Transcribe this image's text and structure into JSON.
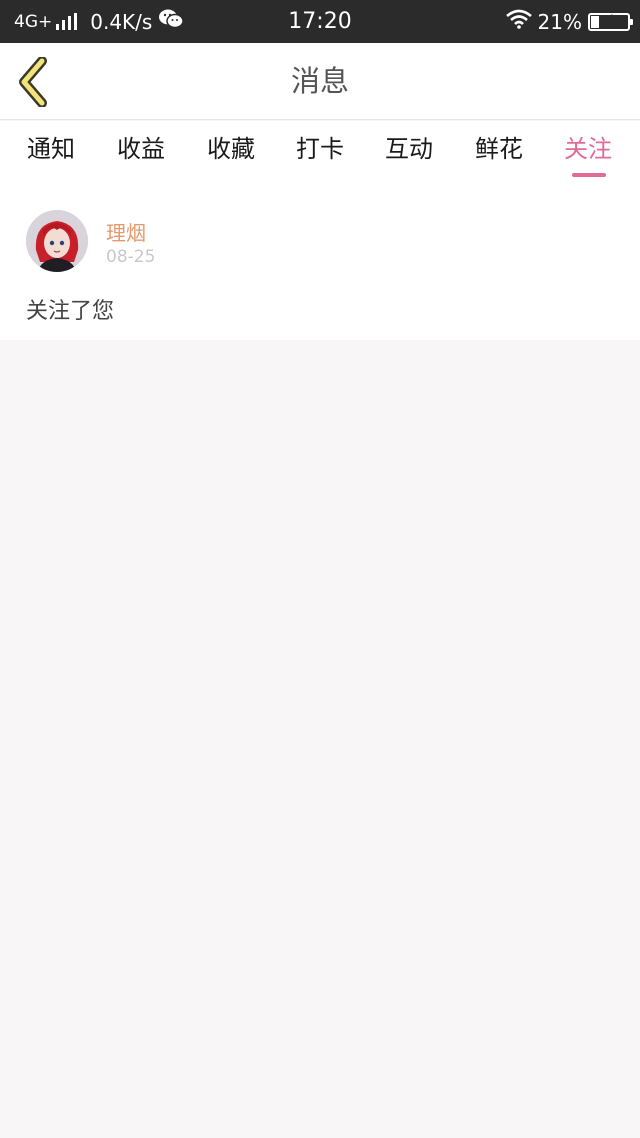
{
  "status_bar": {
    "network": "4G+",
    "speed": "0.4K/s",
    "time": "17:20",
    "battery": "21%",
    "battery_level": 0.21
  },
  "header": {
    "title": "消息"
  },
  "tabs": [
    {
      "label": "通知"
    },
    {
      "label": "收益"
    },
    {
      "label": "收藏"
    },
    {
      "label": "打卡"
    },
    {
      "label": "互动"
    },
    {
      "label": "鲜花"
    },
    {
      "label": "关注"
    }
  ],
  "active_tab": "关注",
  "messages": [
    {
      "username": "理烟",
      "date": "08-25",
      "text": "关注了您"
    }
  ],
  "colors": {
    "accent": "#e06b98",
    "username": "#e39a6c",
    "back_arrow_fill": "#f2e47a"
  }
}
